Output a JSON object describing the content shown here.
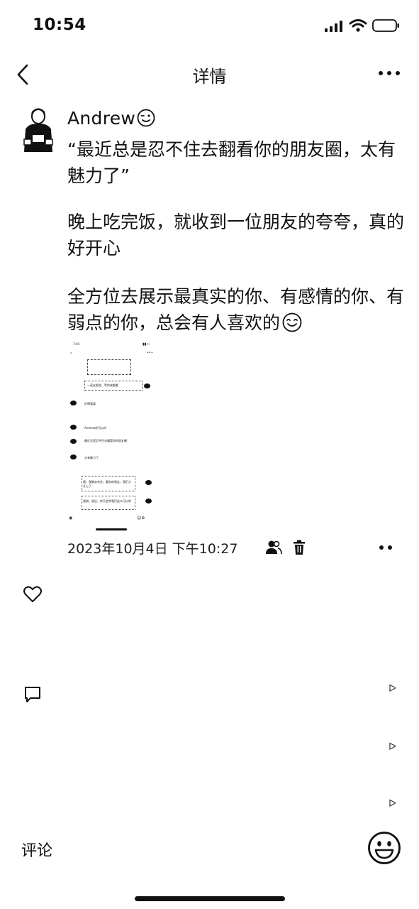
{
  "status_bar": {
    "time": "10:54"
  },
  "nav": {
    "title": "详情"
  },
  "post": {
    "author": "Andrew",
    "paragraphs": [
      "“最近总是忍不住去翻看你的朋友圈，太有魅力了”",
      "晚上吃完饭，就收到一位朋友的夸夸，真的好开心",
      "全方位去展示最真实的你、有感情的你、有弱点的你，总会有人喜欢的"
    ],
    "timestamp": "2023年10月4日 下午10:27"
  },
  "thumbnail": {
    "time": "7:40",
    "lines": [
      "一直在那里，等你来翻看",
      "好啊看看",
      "Andrew你可以吗",
      "最近总是忍不住去翻看你的朋友圈",
      "太有魅力了",
      "哦，我确实有些，看你的朋友，我们大开心了",
      "感谢，饭后，你又会夸我们这么可以的"
    ]
  },
  "comment": {
    "label": "评论"
  },
  "icons": {
    "back": "chevron-left-icon",
    "more": "more-horizontal-icon",
    "wink": "wink-emoji-icon",
    "smile": "smile-emoji-icon",
    "privacy": "people-icon",
    "delete": "trash-icon",
    "like": "heart-icon",
    "comment": "comment-bubble-icon",
    "emoji": "emoji-face-icon"
  }
}
